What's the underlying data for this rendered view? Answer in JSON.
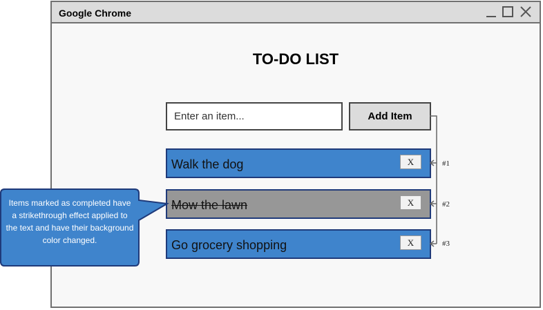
{
  "window": {
    "title": "Google Chrome"
  },
  "page": {
    "title": "TO-DO LIST"
  },
  "input": {
    "placeholder": "Enter an item..."
  },
  "add_button": {
    "label": "Add Item"
  },
  "items": [
    {
      "text": "Walk the dog",
      "delete_label": "X",
      "number": "#1",
      "completed": false
    },
    {
      "text": "Mow the lawn",
      "delete_label": "X",
      "number": "#2",
      "completed": true
    },
    {
      "text": "Go grocery shopping",
      "delete_label": "X",
      "number": "#3",
      "completed": false
    }
  ],
  "callout": {
    "text": "Items marked as completed have a strikethrough effect applied to the text and have their background color changed."
  },
  "colors": {
    "item_active": "#3f84cc",
    "item_completed": "#979797",
    "callout": "#3f84cc",
    "item_border": "#1f3a7a"
  }
}
